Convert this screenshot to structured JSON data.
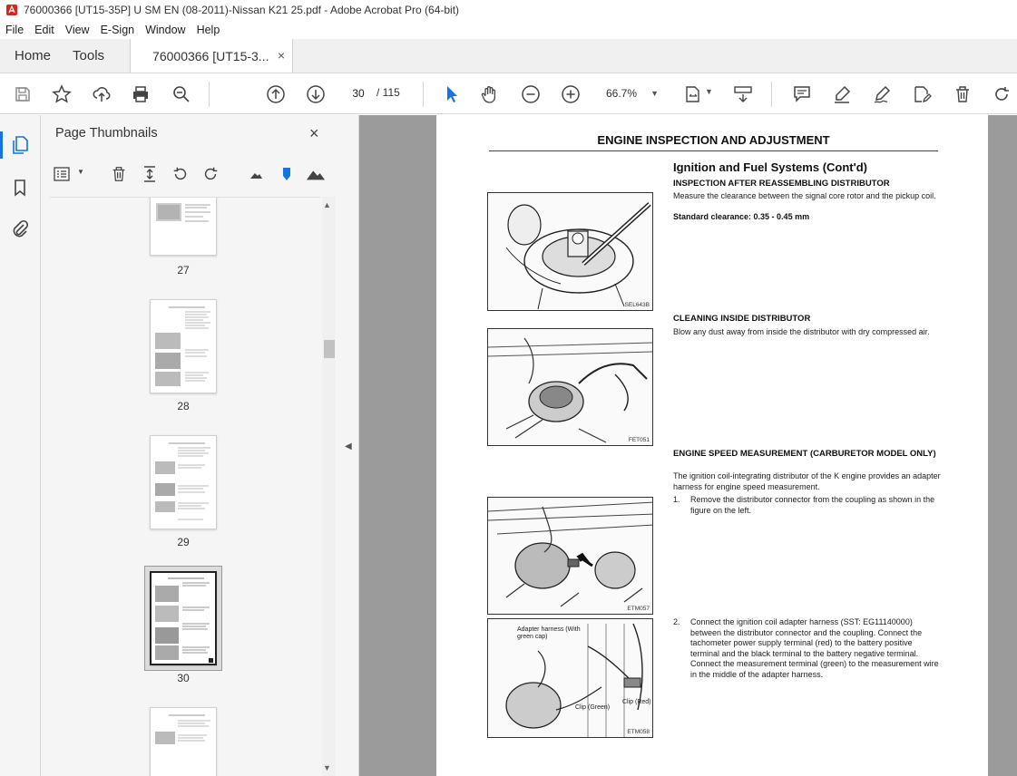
{
  "window": {
    "title": "76000366 [UT15-35P] U SM EN (08-2011)-Nissan K21 25.pdf - Adobe Acrobat Pro (64-bit)"
  },
  "menu": [
    "File",
    "Edit",
    "View",
    "E-Sign",
    "Window",
    "Help"
  ],
  "tabs": {
    "home": "Home",
    "tools": "Tools",
    "document": "76000366 [UT15-3...",
    "close": "×"
  },
  "toolbar": {
    "page_current": "30",
    "page_total": "/ 115",
    "zoom": "66.7%"
  },
  "thumbnails_panel": {
    "title": "Page Thumbnails",
    "close": "×",
    "pages": [
      {
        "label": "27"
      },
      {
        "label": "28"
      },
      {
        "label": "29"
      },
      {
        "label": "30",
        "selected": true
      },
      {
        "label": ""
      }
    ]
  },
  "document_page": {
    "header": "ENGINE INSPECTION AND ADJUSTMENT",
    "section_title": "Ignition and Fuel Systems (Cont'd)",
    "sec1_heading": "INSPECTION AFTER REASSEMBLING DISTRIBUTOR",
    "sec1_text": "Measure the clearance between the signal core rotor and the pickup coil.",
    "sec1_spec": "Standard clearance: 0.35 - 0.45 mm",
    "sec2_heading": "CLEANING INSIDE DISTRIBUTOR",
    "sec2_text": "Blow any dust away from inside the distributor with dry compressed air.",
    "sec3_heading": "ENGINE SPEED MEASUREMENT (CARBURETOR MODEL ONLY)",
    "sec3_text": "The ignition coil-integrating distributor of the K engine provides an adapter harness for engine speed measurement.",
    "step1_num": "1.",
    "step1_text": "Remove the distributor connector from the coupling as shown in the figure on the left.",
    "step2_num": "2.",
    "step2_text": "Connect the ignition coil adapter harness (SST: EG11140000) between the distributor connector and the coupling. Connect the tachometer power supply terminal (red) to the battery positive terminal and the black terminal to the battery negative terminal. Connect the measurement terminal (green) to the measurement wire in the middle of the adapter harness.",
    "fig1_code": "SEL643B",
    "fig2_code": "FET051",
    "fig3_code": "ETM057",
    "fig4_code": "ETM058",
    "fig4_label_harness": "Adapter harness (With green cap)",
    "fig4_label_clip_green": "Clip (Green)",
    "fig4_label_clip_red": "Clip (Red)"
  }
}
